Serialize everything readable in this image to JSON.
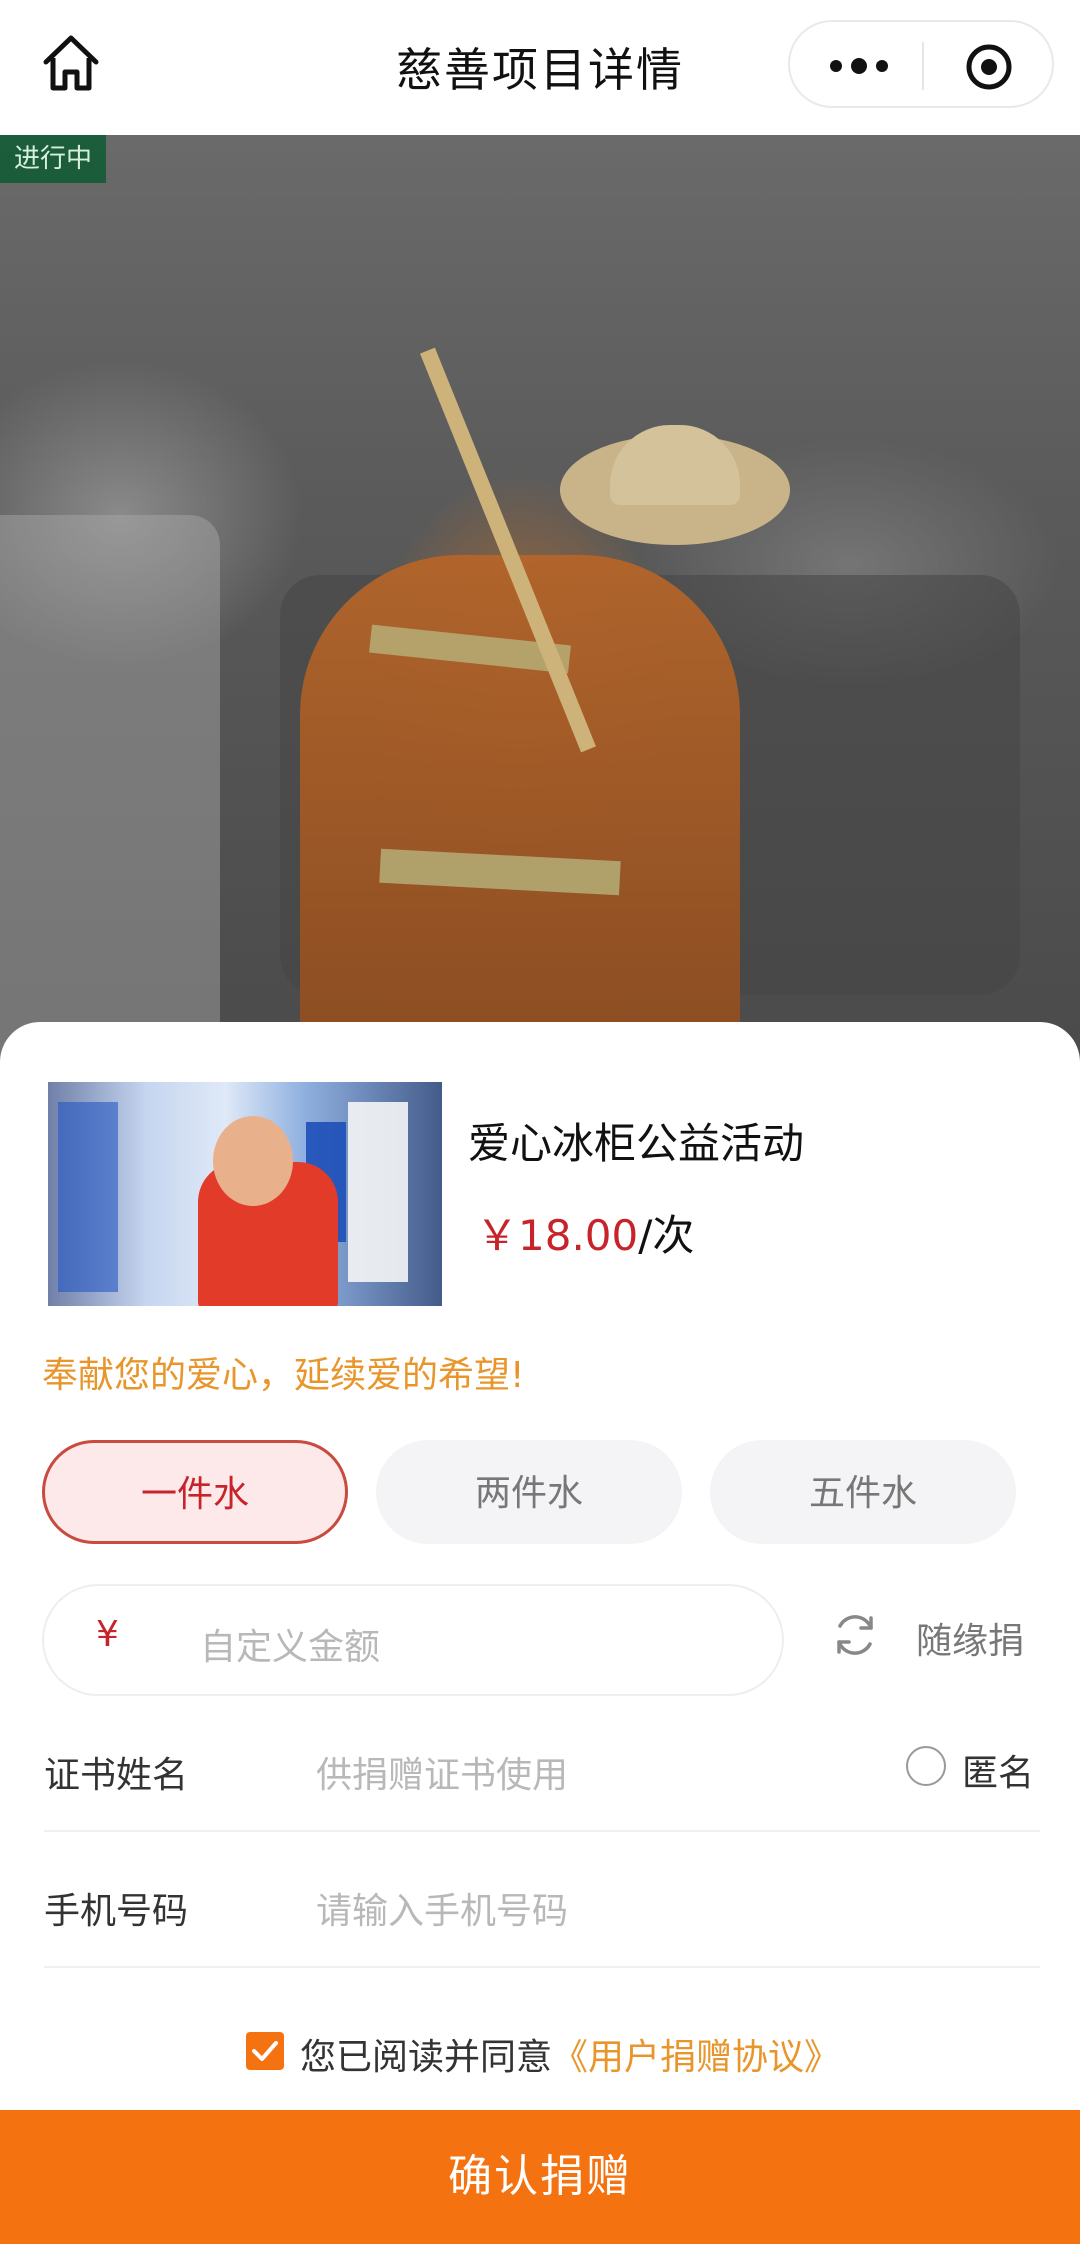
{
  "nav": {
    "title": "慈善项目详情",
    "icons": [
      "home-icon",
      "more-dots-icon",
      "target-icon"
    ]
  },
  "hero": {
    "status_badge": "进行中"
  },
  "project": {
    "name": "爱心冰柜公益活动",
    "price": "￥18.00",
    "price_unit": "/次"
  },
  "slogan": "奉献您的爱心，延续爱的希望!",
  "options": [
    {
      "label": "一件水",
      "selected": true
    },
    {
      "label": "两件水",
      "selected": false
    },
    {
      "label": "五件水",
      "selected": false
    }
  ],
  "custom_amount": {
    "currency": "¥",
    "placeholder": "自定义金额",
    "random_label": "随缘捐"
  },
  "form": {
    "cert_name_label": "证书姓名",
    "cert_name_placeholder": "供捐赠证书使用",
    "anonymous_label": "匿名",
    "phone_label": "手机号码",
    "phone_placeholder": "请输入手机号码"
  },
  "agreement": {
    "checked": true,
    "text": "您已阅读并同意",
    "link": "《用户捐赠协议》"
  },
  "submit_label": "确认捐赠",
  "colors": {
    "accent": "#f57210",
    "price_red": "#c6242a",
    "slogan_orange": "#e8962c"
  }
}
